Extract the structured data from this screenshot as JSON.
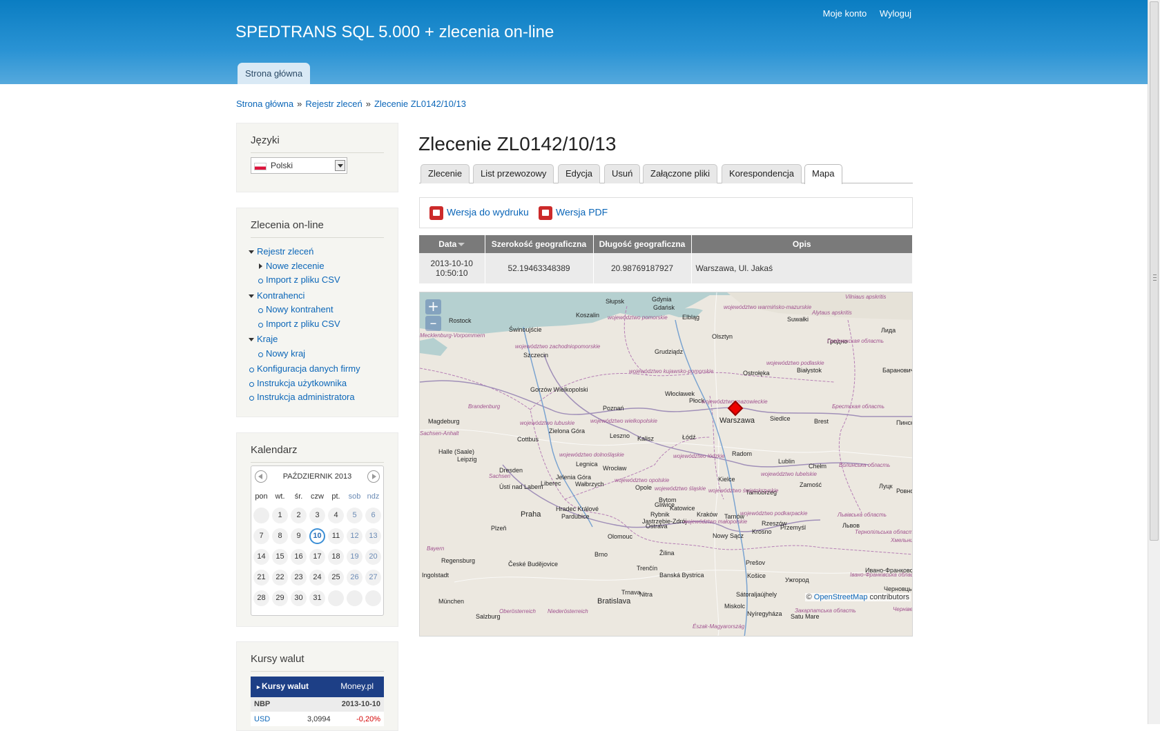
{
  "header": {
    "site_name": "SPEDTRANS SQL 5.000 + zlecenia on-line",
    "account_link": "Moje konto",
    "logout_link": "Wyloguj",
    "primary_tab": "Strona główna"
  },
  "breadcrumb": {
    "items": [
      "Strona główna",
      "Rejestr zleceń",
      "Zlecenie ZL0142/10/13"
    ],
    "separator": "»"
  },
  "sidebar": {
    "languages": {
      "title": "Języki",
      "selected": "Polski"
    },
    "orders": {
      "title": "Zlecenia on-line",
      "items": [
        "Rejestr zleceń",
        "Nowe zlecenie",
        "Import z pliku CSV",
        "Kontrahenci",
        "Nowy kontrahent",
        "Import z pliku CSV",
        "Kraje",
        "Nowy kraj",
        "Konfiguracja danych firmy",
        "Instrukcja użytkownika",
        "Instrukcja administratora"
      ]
    },
    "calendar": {
      "title": "Kalendarz",
      "month": "PAŹDZIERNIK 2013",
      "weekdays": [
        "pon",
        "wt.",
        "śr.",
        "czw",
        "pt.",
        "sob",
        "ndz"
      ],
      "days": [
        "",
        "1",
        "2",
        "3",
        "4",
        "5",
        "6",
        "7",
        "8",
        "9",
        "10",
        "11",
        "12",
        "13",
        "14",
        "15",
        "16",
        "17",
        "18",
        "19",
        "20",
        "21",
        "22",
        "23",
        "24",
        "25",
        "26",
        "27",
        "28",
        "29",
        "30",
        "31",
        "",
        "",
        ""
      ],
      "today": "10"
    },
    "currency": {
      "title": "Kursy walut",
      "widget_title": "Kursy walut",
      "brand": "Money.pl",
      "source": "NBP",
      "date": "2013-10-10",
      "rows": [
        {
          "code": "USD",
          "rate": "3,0994",
          "change": "-0,20%"
        }
      ]
    }
  },
  "main": {
    "title": "Zlecenie ZL0142/10/13",
    "tabs": [
      "Zlecenie",
      "List przewozowy",
      "Edycja",
      "Usuń",
      "Załączone pliki",
      "Korespondencja",
      "Mapa"
    ],
    "active_tab": "Mapa",
    "actions": {
      "print": "Wersja do wydruku",
      "pdf": "Wersja PDF"
    },
    "table": {
      "columns": [
        "Data",
        "Szerokość geograficzna",
        "Długość geograficzna",
        "Opis"
      ],
      "rows": [
        {
          "date": "2013-10-10",
          "time": "10:50:10",
          "lat": "52.19463348389",
          "lon": "20.98769187927",
          "desc": "Warszawa, Ul. Jakaś"
        }
      ]
    },
    "map": {
      "zoom_in": "+",
      "zoom_out": "–",
      "attribution_prefix": "©",
      "attribution_link": "OpenStreetMap",
      "attribution_suffix": "contributors",
      "marker_label": "Warszawa",
      "cities": [
        "Słupsk",
        "Gdynia",
        "Gdańsk",
        "Rostock",
        "Koszalin",
        "Elbląg",
        "Olsztyn",
        "Suwałki",
        "Świnoujście",
        "Szczecin",
        "Grudziądz",
        "Białystok",
        "Ostrołęka",
        "Gorzów Wielkopolski",
        "Włocławek",
        "Płock",
        "Poznań",
        "Siedlce",
        "Brest",
        "Magdeburg",
        "Zielona Góra",
        "Leszno",
        "Kalisz",
        "Łódź",
        "Cottbus",
        "Halle (Saale)",
        "Leipzig",
        "Radom",
        "Lublin",
        "Chełm",
        "Dresden",
        "Legnica",
        "Wrocław",
        "Jelenia Góra",
        "Wałbrzych",
        "Liberec",
        "Ústí nad Labem",
        "Kielce",
        "Zamość",
        "Opole",
        "Tarnobrzeg",
        "Praha",
        "Hradec Králové",
        "Pardubice",
        "Gliwice",
        "Katowice",
        "Kraków",
        "Rybnik",
        "Jastrzębie-Zdrój",
        "Ostrava",
        "Olomouc",
        "Nowy Sącz",
        "Krosno",
        "Przemyśl",
        "Plzeň",
        "Brno",
        "Žilina",
        "Trenčín",
        "Banská Bystrica",
        "Prešov",
        "Košice",
        "Regensburg",
        "České Budějovice",
        "Ingolstadt",
        "Bratislava",
        "Trnava",
        "Nitra",
        "München",
        "Salzburg",
        "Miskolc",
        "Nyíregyháza",
        "Satu Mare",
        "Sátoraljaújhely",
        "Ужгород",
        "Лида",
        "Гродно",
        "Барановичи",
        "Пинск",
        "Луцк",
        "Ровно",
        "Львов",
        "Ивано-Франковск",
        "Черновцы",
        "Tarnów",
        "Rzeszów",
        "Bytom"
      ],
      "regions": [
        "województwo pomorskie",
        "województwo warmińsko-mazurskie",
        "Alytaus apskritis",
        "Vilniaus apskritis",
        "Mecklenburg-Vorpommern",
        "województwo zachodniopomorskie",
        "województwo kujawsko-pomorskie",
        "województwo podlaskie",
        "Гродненская область",
        "Brandenburg",
        "województwo lubuskie",
        "województwo wielkopolskie",
        "województwo mazowieckie",
        "Брестская область",
        "Sachsen-Anhalt",
        "województwo łódzkie",
        "województwo dolnośląskie",
        "województwo opolskie",
        "województwo lubelskie",
        "Волинська область",
        "Sachsen",
        "województwo świętokrzyskie",
        "województwo śląskie",
        "województwo małopolskie",
        "województwo podkarpackie",
        "Львівська область",
        "Тернопільська область",
        "Хмельницька",
        "Bayern",
        "Oberösterreich",
        "Niederösterreich",
        "Закарпатська область",
        "Івано-Франківська область",
        "Чернівецька область",
        "Észak-Magyarország"
      ]
    }
  }
}
